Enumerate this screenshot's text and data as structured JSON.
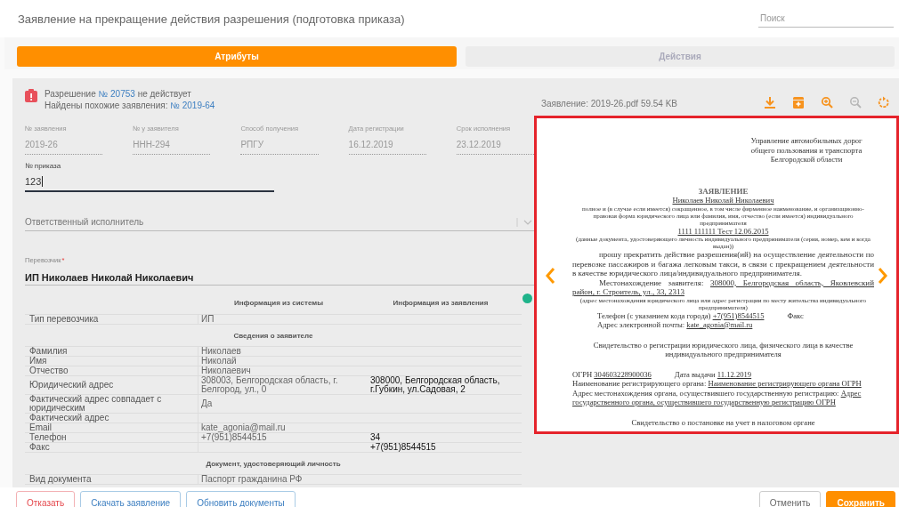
{
  "header": {
    "title": "Заявление на прекращение действия разрешения (подготовка приказа)",
    "search": {
      "placeholder": "Поиск"
    }
  },
  "tabs": [
    {
      "label": "Атрибуты",
      "selected": true
    },
    {
      "label": "Действия",
      "selected": false
    }
  ],
  "alert": {
    "lines": [
      {
        "parts": [
          {
            "text": "Разрешение ",
            "link": false
          },
          {
            "text": "№ 20753",
            "link": true
          },
          {
            "text": " не действует",
            "link": false
          }
        ]
      },
      {
        "parts": [
          {
            "text": "Найдены похожие заявления: ",
            "link": false
          },
          {
            "text": "№ 2019-64",
            "link": true
          }
        ]
      }
    ]
  },
  "info_fields": [
    {
      "label": "№ заявления",
      "value": "2019-26"
    },
    {
      "label": "№ у заявителя",
      "value": "ННН-294"
    },
    {
      "label": "Способ получения",
      "value": "РПГУ"
    },
    {
      "label": "Дата регистрации",
      "value": "16.12.2019"
    },
    {
      "label": "Срок исполнения",
      "value": "23.12.2019"
    }
  ],
  "order_field": {
    "label": "№ приказа",
    "value": "123",
    "focused": true
  },
  "executor_select": {
    "placeholder": "Ответственный исполнитель"
  },
  "carrier_field": {
    "label": "Перевозчик",
    "required": true,
    "required_marker": "*",
    "value": "ИП Николаев Николай Николаевич"
  },
  "table": {
    "columns": [
      "Информация из системы",
      "Информация из заявления"
    ],
    "rows": [
      {
        "kind": "row",
        "label": "Тип перевозчика",
        "system": "ИП"
      },
      {
        "kind": "section",
        "label": "Сведения о заявителе"
      },
      {
        "kind": "row",
        "label": "Фамилия",
        "system": "Николаев"
      },
      {
        "kind": "row",
        "label": "Имя",
        "system": "Николай"
      },
      {
        "kind": "row",
        "label": "Отчество",
        "system": "Николаевич"
      },
      {
        "kind": "row",
        "label": "Юридический адрес",
        "system": "308003, Белгородская область, г. Белгород, ул., 0",
        "application": "308000, Белгородская область, г.Губкин, ул.Садовая, 2"
      },
      {
        "kind": "row",
        "label": "Фактический адрес совпадает с юридическим",
        "system": "Да"
      },
      {
        "kind": "row",
        "label": "Фактический адрес"
      },
      {
        "kind": "row",
        "label": "Email",
        "system": "kate_agonia@mail.ru"
      },
      {
        "kind": "row",
        "label": "Телефон",
        "system": "+7(951)8544515",
        "application": "34"
      },
      {
        "kind": "row",
        "label": "Факс",
        "application": "+7(951)8544515"
      },
      {
        "kind": "section",
        "label": "Документ, удостоверяющий личность"
      },
      {
        "kind": "row",
        "label": "Вид документа",
        "system": "Паспорт гражданина РФ"
      }
    ]
  },
  "viewer": {
    "file_label": "Заявление: 2019-26.pdf 59.54 KB",
    "tools": [
      {
        "kind": "download",
        "disabled": false
      },
      {
        "kind": "save",
        "disabled": false
      },
      {
        "kind": "zoom_in",
        "disabled": false
      },
      {
        "kind": "zoom_out",
        "disabled": true
      },
      {
        "kind": "rotate",
        "disabled": false
      }
    ],
    "document": [
      {
        "kind": "addressee",
        "parts": [
          {
            "text": "Управление автомобильных дорог общего пользования и транспорта Белгородской области",
            "underline": false
          }
        ]
      },
      {
        "kind": "title",
        "parts": [
          {
            "text": "ЗАЯВЛЕНИЕ",
            "underline": false
          }
        ]
      },
      {
        "kind": "center",
        "parts": [
          {
            "text": "Николаев Николай Николаевич",
            "underline": true
          }
        ]
      },
      {
        "kind": "note",
        "parts": [
          {
            "text": "полное и (в случае если имеется) сокращенное, в том числе фирменное наименование, и организационно-правовая форма юридического лица или фамилия, имя, отчество (если имеется) индивидуального предпринимателя",
            "underline": false
          }
        ]
      },
      {
        "kind": "center",
        "parts": [
          {
            "text": "1111 111111 Тест 12.06.2015",
            "underline": true
          }
        ]
      },
      {
        "kind": "note",
        "parts": [
          {
            "text": "(данные документа, удостоверяющего личность индивидуального предпринимателя (серия, номер, кем и когда выдан))",
            "underline": false
          }
        ]
      },
      {
        "kind": "body",
        "parts": [
          {
            "text": "прошу прекратить действие разрешения(ий) на осуществление деятельности по перевозке пассажиров и багажа легковым такси, в связи с прекращением деятельности в качестве юридического лица/индивидуального предпринимателя.",
            "underline": false
          }
        ]
      },
      {
        "kind": "body",
        "parts": [
          {
            "text": "Местонахождение заявителя: ",
            "underline": false
          },
          {
            "text": "308000, Белгородская область, Яковлевский район, г. Строитель, ул., 33, 2313",
            "underline": true
          }
        ]
      },
      {
        "kind": "note",
        "parts": [
          {
            "text": "(адрес местонахождения юридического лица или адрес регистрации по месту жительства индивидуального предпринимателя)",
            "underline": false
          }
        ]
      },
      {
        "kind": "line",
        "parts": [
          {
            "text": "Телефон (с указанием кода города) ",
            "underline": false
          },
          {
            "text": "+7(951)8544515",
            "underline": true
          },
          {
            "text": "Факс",
            "underline": false,
            "spaced": true
          }
        ]
      },
      {
        "kind": "line",
        "parts": [
          {
            "text": "Адрес электронной почты: ",
            "underline": false
          },
          {
            "text": "kate_agonia@mail.ru",
            "underline": true
          }
        ]
      },
      {
        "kind": "center",
        "parts": [
          {
            "text": "Свидетельство о регистрации юридического лица, физического лица в качестве индивидуального предпринимателя",
            "underline": false
          }
        ]
      },
      {
        "kind": "plain",
        "parts": [
          {
            "text": "ОГРН ",
            "underline": false
          },
          {
            "text": "304603228900036",
            "underline": true
          },
          {
            "text": "Дата выдачи ",
            "underline": false,
            "spaced": true
          },
          {
            "text": "11.12.2019",
            "underline": true
          }
        ]
      },
      {
        "kind": "plain",
        "parts": [
          {
            "text": "Наименование регистрирующего органа: ",
            "underline": false
          },
          {
            "text": "Наименование регистрирующего органа ОГРН",
            "underline": true
          }
        ]
      },
      {
        "kind": "plain",
        "parts": [
          {
            "text": "Адрес местонахождения органа, осуществившего государственную регистрацию: ",
            "underline": false
          },
          {
            "text": "Адрес государственного органа, осуществившего государственную регистрацию ОГРН",
            "underline": true
          }
        ]
      },
      {
        "kind": "center",
        "parts": [
          {
            "text": "Свидетельство о постановке на учет в налоговом органе",
            "underline": false
          }
        ]
      }
    ]
  },
  "buttons_left": [
    {
      "label": "Отказать",
      "kind": "danger"
    },
    {
      "label": "Скачать заявление",
      "kind": "secondary"
    },
    {
      "label": "Обновить документы",
      "kind": "secondary"
    }
  ],
  "buttons_right": [
    {
      "label": "Отменить",
      "kind": "default"
    },
    {
      "label": "Сохранить",
      "kind": "primary"
    }
  ]
}
